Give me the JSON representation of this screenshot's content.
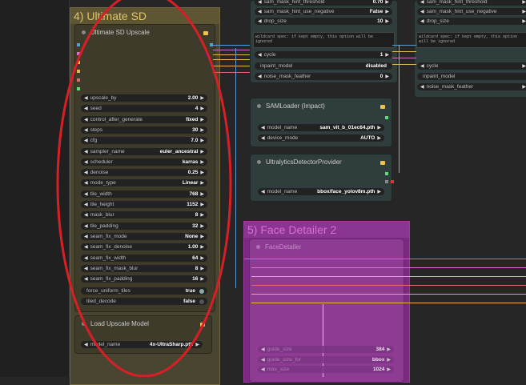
{
  "groups": {
    "g4": {
      "title": "4) Ultimate SD"
    },
    "g5": {
      "title": "5) Face Detailer 2"
    }
  },
  "usd_node": {
    "title": "Ultimate SD Upscale",
    "widgets": [
      {
        "label": "upscale_by",
        "value": "2.00"
      },
      {
        "label": "seed",
        "value": "4"
      },
      {
        "label": "control_after_generate",
        "value": "fixed"
      },
      {
        "label": "steps",
        "value": "30"
      },
      {
        "label": "cfg",
        "value": "7.0"
      },
      {
        "label": "sampler_name",
        "value": "euler_ancestral"
      },
      {
        "label": "scheduler",
        "value": "karras"
      },
      {
        "label": "denoise",
        "value": "0.25"
      },
      {
        "label": "mode_type",
        "value": "Linear"
      },
      {
        "label": "tile_width",
        "value": "768"
      },
      {
        "label": "tile_height",
        "value": "1152"
      },
      {
        "label": "mask_blur",
        "value": "8"
      },
      {
        "label": "tile_padding",
        "value": "32"
      },
      {
        "label": "seam_fix_mode",
        "value": "None"
      },
      {
        "label": "seam_fix_denoise",
        "value": "1.00"
      },
      {
        "label": "seam_fix_width",
        "value": "64"
      },
      {
        "label": "seam_fix_mask_blur",
        "value": "8"
      },
      {
        "label": "seam_fix_padding",
        "value": "16"
      }
    ],
    "toggles": [
      {
        "label": "force_uniform_tiles",
        "value": "true"
      },
      {
        "label": "tiled_decode",
        "value": "false"
      }
    ]
  },
  "load_upscale": {
    "title": "Load Upscale Model",
    "widget": {
      "label": "model_name",
      "value": "4x-UltraSharp.pth"
    }
  },
  "detailer1": {
    "top_widgets": [
      {
        "label": "sam_mask_hint_threshold",
        "value": "0.70"
      },
      {
        "label": "sam_mask_hint_use_negative",
        "value": "False"
      },
      {
        "label": "drop_size",
        "value": "10"
      }
    ],
    "wildcard": "wildcard spec: if kept empty, this option will be ignored",
    "cycle": {
      "label": "cycle",
      "value": "1"
    },
    "inpaint_model": {
      "label": "inpaint_model",
      "value": "disabled"
    },
    "noise_mask_feather": {
      "label": "noise_mask_feather",
      "value": "0"
    }
  },
  "detailer_right": {
    "widgets": [
      "sam_mask_hint_threshold",
      "sam_mask_hint_use_negative",
      "drop_size"
    ],
    "wildcard": "wildcard spec: if kept empty, this option will be ignored",
    "cycle": "cycle",
    "inpaint_model": "inpaint_model",
    "noise_mask_feather": "noise_mask_feather"
  },
  "samloader": {
    "title": "SAMLoader (Impact)",
    "widgets": [
      {
        "label": "model_name",
        "value": "sam_vit_b_01ec64.pth"
      },
      {
        "label": "device_mode",
        "value": "AUTO"
      }
    ]
  },
  "ultralytics": {
    "title": "UltralyticsDetectorProvider",
    "widget": {
      "label": "model_name",
      "value": "bbox/face_yolov8m.pth"
    }
  },
  "face_detailer": {
    "title": "FaceDetailer",
    "widgets": [
      {
        "label": "guide_size",
        "value": "384"
      },
      {
        "label": "guide_size_for",
        "value": "bbox"
      },
      {
        "label": "max_size",
        "value": "1024"
      }
    ]
  },
  "colors": {
    "annotation": "#d81f26",
    "group4": "#8a7a3a",
    "group5": "#a43fa8"
  }
}
